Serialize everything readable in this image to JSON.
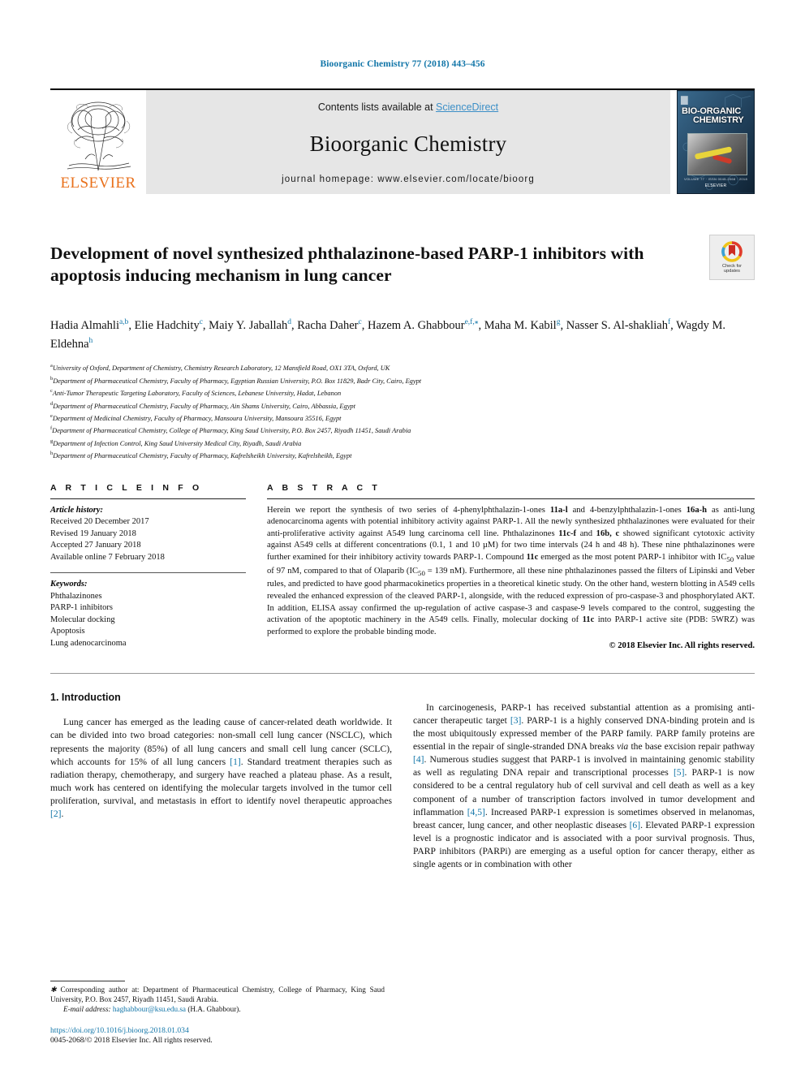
{
  "running_head": "Bioorganic Chemistry 77 (2018) 443–456",
  "banner": {
    "publisher_name": "ELSEVIER",
    "contents_prefix": "Contents lists available at ",
    "contents_link": "ScienceDirect",
    "journal_name": "Bioorganic Chemistry",
    "homepage": "journal homepage: www.elsevier.com/locate/bioorg",
    "cover_title_line1": "BIO-ORGANIC",
    "cover_title_line2": "CHEMISTRY",
    "cover_footer": "VOLUME 77 · ISSN 0045-2068 · 2018",
    "cover_publisher": "ELSEVIER"
  },
  "article": {
    "title": "Development of novel synthesized phthalazinone-based PARP-1 inhibitors with apoptosis inducing mechanism in lung cancer",
    "crossmark_label_1": "Check for",
    "crossmark_label_2": "updates",
    "authors": [
      {
        "name": "Hadia Almahli",
        "marks": "a,b",
        "sep": ", "
      },
      {
        "name": "Elie Hadchity",
        "marks": "c",
        "sep": ", "
      },
      {
        "name": "Maiy Y. Jaballah",
        "marks": "d",
        "sep": ", "
      },
      {
        "name": "Racha Daher",
        "marks": "c",
        "sep": ", "
      },
      {
        "name": "Hazem A. Ghabbour",
        "marks": "e,f,⁎",
        "sep": ", "
      },
      {
        "name": "Maha M. Kabil",
        "marks": "g",
        "sep": ", "
      },
      {
        "name": "Nasser S. Al-shakliah",
        "marks": "f",
        "sep": ", "
      },
      {
        "name": "Wagdy M. Eldehna",
        "marks": "h",
        "sep": ""
      }
    ],
    "affiliations": [
      {
        "mark": "a",
        "text": "University of Oxford, Department of Chemistry, Chemistry Research Laboratory, 12 Mansfield Road, OX1 3TA, Oxford, UK"
      },
      {
        "mark": "b",
        "text": "Department of Pharmaceutical Chemistry, Faculty of Pharmacy, Egyptian Russian University, P.O. Box 11829, Badr City, Cairo, Egypt"
      },
      {
        "mark": "c",
        "text": "Anti-Tumor Therapeutic Targeting Laboratory, Faculty of Sciences, Lebanese University, Hadat, Lebanon"
      },
      {
        "mark": "d",
        "text": "Department of Pharmaceutical Chemistry, Faculty of Pharmacy, Ain Shams University, Cairo, Abbassia, Egypt"
      },
      {
        "mark": "e",
        "text": "Department of Medicinal Chemistry, Faculty of Pharmacy, Mansoura University, Mansoura 35516, Egypt"
      },
      {
        "mark": "f",
        "text": "Department of Pharmaceutical Chemistry, College of Pharmacy, King Saud University, P.O. Box 2457, Riyadh 11451, Saudi Arabia"
      },
      {
        "mark": "g",
        "text": "Department of Infection Control, King Saud University Medical City, Riyadh, Saudi Arabia"
      },
      {
        "mark": "h",
        "text": "Department of Pharmaceutical Chemistry, Faculty of Pharmacy, Kafrelsheikh University, Kafrelsheikh, Egypt"
      }
    ]
  },
  "article_info": {
    "heading": "A R T I C L E   I N F O",
    "history_label": "Article history:",
    "history": [
      "Received 20 December 2017",
      "Revised 19 January 2018",
      "Accepted 27 January 2018",
      "Available online 7 February 2018"
    ],
    "keywords_label": "Keywords:",
    "keywords": [
      "Phthalazinones",
      "PARP-1 inhibitors",
      "Molecular docking",
      "Apoptosis",
      "Lung adenocarcinoma"
    ]
  },
  "abstract": {
    "heading": "A B S T R A C T",
    "html": "Herein we report the synthesis of two series of 4-phenylphthalazin-1-ones <b>11a-l</b> and 4-benzylphthalazin-1-ones <b>16a-h</b> as anti-lung adenocarcinoma agents with potential inhibitory activity against PARP-1. All the newly synthesized phthalazinones were evaluated for their anti-proliferative activity against A549 lung carcinoma cell line. Phthalazinones <b>11c-f</b> and <b>16b, c</b> showed significant cytotoxic activity against A549 cells at different concentrations (0.1, 1 and 10 &micro;M) for two time intervals (24 h and 48 h). These nine phthalazinones were further examined for their inhibitory activity towards PARP-1. Compound <b>11c</b> emerged as the most potent PARP-1 inhibitor with IC<sub>50</sub> value of 97 nM, compared to that of Olaparib (IC<sub>50</sub> = 139 nM). Furthermore, all these nine phthalazinones passed the filters of Lipinski and Veber rules, and predicted to have good pharmacokinetics properties in a theoretical kinetic study. On the other hand, western blotting in A549 cells revealed the enhanced expression of the cleaved PARP-1, alongside, with the reduced expression of pro-caspase-3 and phosphorylated AKT. In addition, ELISA assay confirmed the up-regulation of active caspase-3 and caspase-9 levels compared to the control, suggesting the activation of the apoptotic machinery in the A549 cells. Finally, molecular docking of <b>11c</b> into PARP-1 active site (PDB: 5WRZ) was performed to explore the probable binding mode.",
    "copyright": "© 2018 Elsevier Inc. All rights reserved."
  },
  "body": {
    "section_heading": "1. Introduction",
    "left_paragraph_html": "Lung cancer has emerged as the leading cause of cancer-related death worldwide. It can be divided into two broad categories: non-small cell lung cancer (NSCLC), which represents the majority (85%) of all lung cancers and small cell lung cancer (SCLC), which accounts for 15% of all lung cancers <span class=\"ref\">[1]</span>. Standard treatment therapies such as radiation therapy, chemotherapy, and surgery have reached a plateau phase. As a result, much work has centered on identifying the molecular targets involved in the tumor cell proliferation, survival, and metastasis in effort to identify novel therapeutic approaches <span class=\"ref\">[2]</span>.",
    "right_paragraph_html": "In carcinogenesis, PARP-1 has received substantial attention as a promising anti-cancer therapeutic target <span class=\"ref\">[3]</span>. PARP-1 is a highly conserved DNA-binding protein and is the most ubiquitously expressed member of the PARP family. PARP family proteins are essential in the repair of single-stranded DNA breaks <span class=\"ital-i\">via</span> the base excision repair pathway <span class=\"ref\">[4]</span>. Numerous studies suggest that PARP-1 is involved in maintaining genomic stability as well as regulating DNA repair and transcriptional processes <span class=\"ref\">[5]</span>. PARP-1 is now considered to be a central regulatory hub of cell survival and cell death as well as a key component of a number of transcription factors involved in tumor development and inflammation <span class=\"ref\">[4,5]</span>. Increased PARP-1 expression is sometimes observed in melanomas, breast cancer, lung cancer, and other neoplastic diseases <span class=\"ref\">[6]</span>. Elevated PARP-1 expression level is a prognostic indicator and is associated with a poor survival prognosis. Thus, PARP inhibitors (PARPi) are emerging as a useful option for cancer therapy, either as single agents or in combination with other"
  },
  "footnotes": {
    "corresponding_html": "<span class=\"em\">&#10033;</span> Corresponding author at: Department of Pharmaceutical Chemistry, College of Pharmacy, King Saud University, P.O. Box 2457, Riyadh 11451, Saudi Arabia.",
    "email_html": "<span class=\"em\">E-mail address:</span> <span class=\"ref\">haghabbour@ksu.edu.sa</span> (H.A. Ghabbour).",
    "doi": "https://doi.org/10.1016/j.bioorg.2018.01.034",
    "issn_line": "0045-2068/© 2018 Elsevier Inc. All rights reserved."
  },
  "colors": {
    "link_blue": "#1175a8",
    "sciencedirect_blue": "#3c8fc7",
    "elsevier_orange": "#E9711C",
    "banner_grey": "#e6e6e6"
  }
}
